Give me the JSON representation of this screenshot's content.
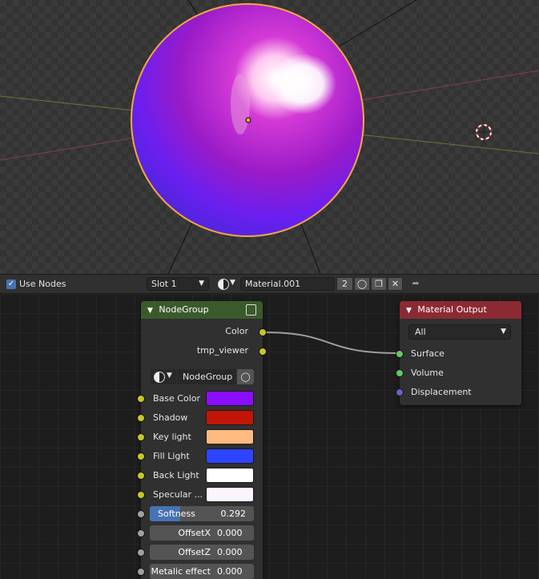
{
  "header": {
    "use_nodes_label": "Use Nodes",
    "use_nodes_checked": "✓",
    "slot": "Slot 1",
    "material_name": "Material.001",
    "user_count": "2"
  },
  "nodegroup": {
    "title": "NodeGroup",
    "outputs": [
      "Color",
      "tmp_viewer"
    ],
    "group_name": "NodeGroup",
    "colors": [
      {
        "label": "Base Color",
        "color": "#8a0dff"
      },
      {
        "label": "Shadow",
        "color": "#c11608"
      },
      {
        "label": "Key light",
        "color": "#ffba80"
      },
      {
        "label": "Fill Light",
        "color": "#2f44ff"
      },
      {
        "label": "Back Light",
        "color": "#ffffff"
      },
      {
        "label": "Specular ...",
        "color": "#fbf5ff"
      }
    ],
    "values": [
      {
        "label": "Softness",
        "value": "0.292",
        "fraction": 0.292
      },
      {
        "label": "OffsetX",
        "value": "0.000"
      },
      {
        "label": "OffsetZ",
        "value": "0.000"
      },
      {
        "label": "Metalic effect",
        "value": "0.000"
      }
    ]
  },
  "output_node": {
    "title": "Material Output",
    "target": "All",
    "inputs": [
      "Surface",
      "Volume",
      "Displacement"
    ]
  },
  "colors": {
    "group_header": "#3b5a2c",
    "output_header": "#8c2a33",
    "socket_color": "#c7c729",
    "socket_shader": "#63c763",
    "socket_vector": "#6363c7",
    "socket_float": "#a1a1a1",
    "accent": "#4772b3"
  }
}
